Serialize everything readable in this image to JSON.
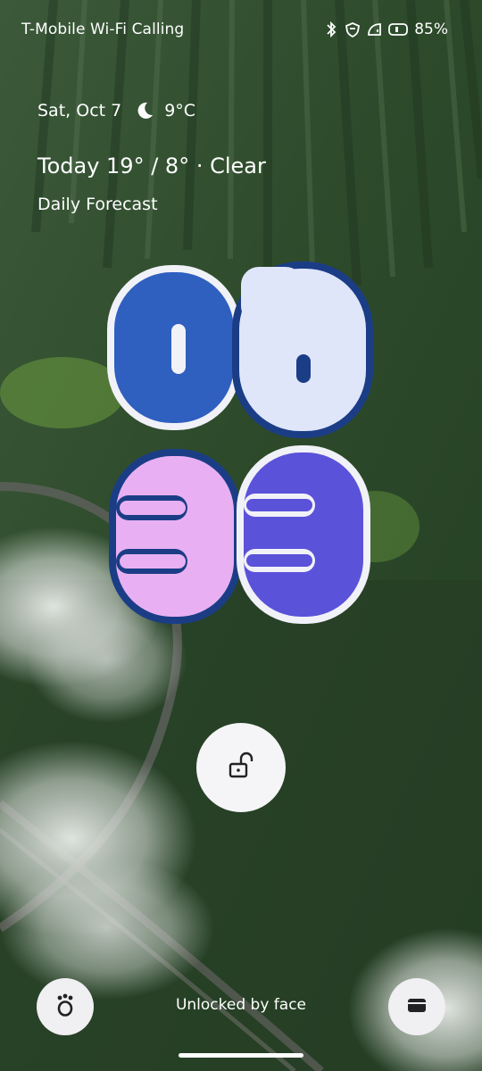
{
  "status_bar": {
    "carrier": "T-Mobile Wi-Fi Calling",
    "icons": [
      "bluetooth-icon",
      "vpn-icon",
      "wifi-calling-icon",
      "battery-icon"
    ],
    "battery_percent": "85%"
  },
  "weather": {
    "date": "Sat, Oct 7",
    "condition_icon": "moon-icon",
    "temperature": "9°C",
    "forecast": "Today 19° / 8° · Clear",
    "forecast_label": "Daily Forecast"
  },
  "clock": {
    "hour_digits": [
      "0",
      "6"
    ],
    "minute_digits": [
      "3",
      "3"
    ],
    "colors": {
      "digit_0": "#2f5fbf",
      "digit_6": "#dfe6fa",
      "digit_3a": "#e8b0f2",
      "digit_3b": "#5a52d9",
      "outline_dark": "#1b3d86",
      "outline_light": "#f1f1f8"
    }
  },
  "lock": {
    "unlock_icon": "unlocked-padlock-icon"
  },
  "bottom": {
    "left_shortcut_icon": "pet-paw-icon",
    "right_shortcut_icon": "wallet-icon",
    "unlock_message": "Unlocked by face"
  }
}
